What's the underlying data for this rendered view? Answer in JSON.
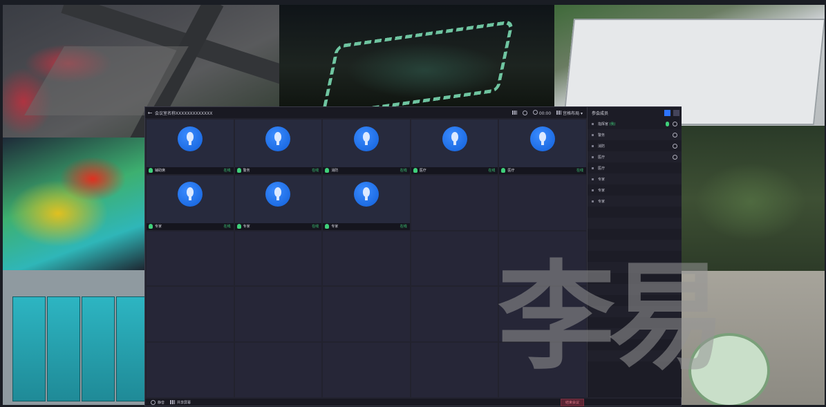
{
  "window": {
    "title": "会议室名称XXXXXXXXXXXXX",
    "time": "00:00",
    "layout_label": "宫格布局"
  },
  "tiles": [
    {
      "name": "辅助席",
      "status": "在线"
    },
    {
      "name": "警务",
      "status": "在线"
    },
    {
      "name": "消防",
      "status": "在线"
    },
    {
      "name": "医疗",
      "status": "在线"
    },
    {
      "name": "医疗",
      "status": "在线"
    },
    {
      "name": "专家",
      "status": "在线"
    },
    {
      "name": "专家",
      "status": "在线"
    },
    {
      "name": "专家",
      "status": "在线"
    }
  ],
  "panel": {
    "title": "参会成员",
    "members": [
      {
        "name": "指挥官",
        "tag": "(我)"
      },
      {
        "name": "警务",
        "tag": ""
      },
      {
        "name": "消防",
        "tag": ""
      },
      {
        "name": "医疗",
        "tag": ""
      },
      {
        "name": "医疗",
        "tag": ""
      },
      {
        "name": "专家",
        "tag": ""
      },
      {
        "name": "专家",
        "tag": ""
      },
      {
        "name": "专家",
        "tag": ""
      }
    ]
  },
  "footer": {
    "mute_label": "静音",
    "share_label": "共享屏幕",
    "end_label": "结束会议"
  },
  "watermark": "李易"
}
